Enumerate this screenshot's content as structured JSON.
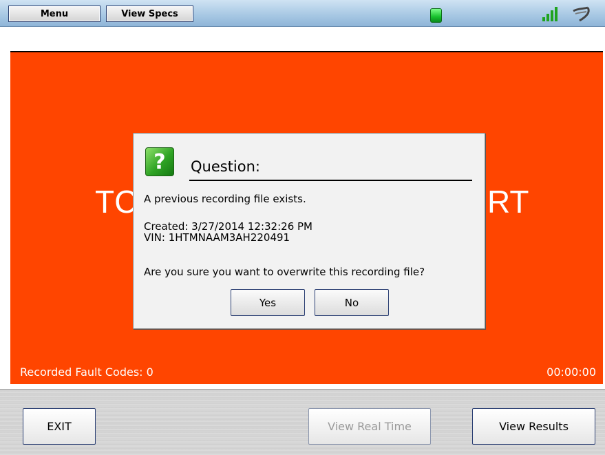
{
  "topbar": {
    "menu_label": "Menu",
    "view_specs_label": "View Specs",
    "status_color": "#17c12d"
  },
  "main": {
    "background_color": "#ff4500",
    "title_left": "TC",
    "title_right": "RT",
    "fault_codes_label": "Recorded Fault Codes: 0",
    "timer": "00:00:00"
  },
  "dialog": {
    "icon": "question-icon",
    "title": "Question:",
    "message": "A previous recording file exists.",
    "created": "Created: 3/27/2014 12:32:26 PM",
    "vin": "VIN: 1HTMNAAM3AH220491",
    "question": "Are you sure you want to overwrite this recording file?",
    "yes_label": "Yes",
    "no_label": "No"
  },
  "bottombar": {
    "exit_label": "EXIT",
    "view_real_time_label": "View Real Time",
    "view_results_label": "View Results"
  }
}
